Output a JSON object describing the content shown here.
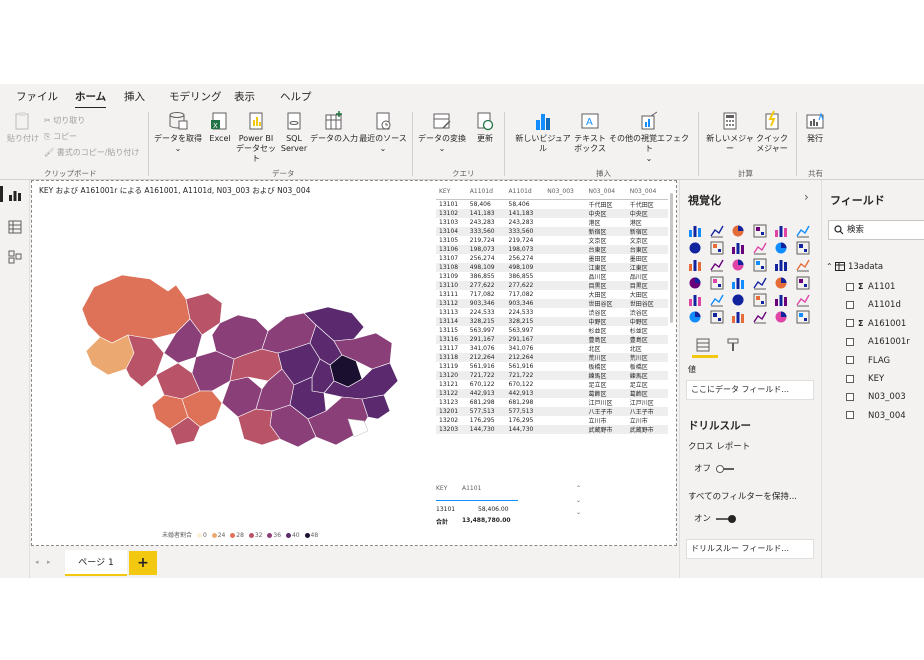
{
  "tabs": [
    "ファイル",
    "ホーム",
    "挿入",
    "モデリング",
    "表示",
    "ヘルプ"
  ],
  "active_tab": "ホーム",
  "ribbon": {
    "clipboard": {
      "paste": "貼り付け",
      "cut": "切り取り",
      "copy": "コピー",
      "format_painter": "書式のコピー/貼り付け",
      "group": "クリップボード"
    },
    "data": {
      "get_data": "データを取得",
      "excel": "Excel",
      "pbi_l1": "Power BI",
      "pbi_l2": "データセット",
      "sql_l1": "SQL",
      "sql_l2": "Server",
      "enter_data": "データの入力",
      "recent_sources": "最近のソース",
      "group": "データ"
    },
    "query": {
      "transform": "データの変換",
      "refresh": "更新",
      "group": "クエリ"
    },
    "insert": {
      "new_visual": "新しいビジュアル",
      "text_l1": "テキスト",
      "text_l2": "ボックス",
      "more_visuals": "その他の視覚エフェクト",
      "group": "挿入"
    },
    "calc": {
      "new_measure": "新しいメジャー",
      "quick_l1": "クイック",
      "quick_l2": "メジャー",
      "group": "計算"
    },
    "share": {
      "publish": "発行",
      "group": "共有"
    }
  },
  "map_visual": {
    "title": "KEY および A161001r による A161001, A1101d, N03_003 および N03_004",
    "legend_title": "未婚者割合",
    "legend": [
      {
        "label": "0",
        "color": "#fcefd8"
      },
      {
        "label": "24",
        "color": "#eba971"
      },
      {
        "label": "28",
        "color": "#de7259"
      },
      {
        "label": "32",
        "color": "#b95468"
      },
      {
        "label": "36",
        "color": "#8a3f78"
      },
      {
        "label": "40",
        "color": "#5b2a6e"
      },
      {
        "label": "48",
        "color": "#1a0f2e"
      }
    ]
  },
  "table": {
    "headers": [
      "KEY",
      "A1101d",
      "A1101d",
      "N03_003",
      "N03_004",
      "N03_004"
    ],
    "rows": [
      [
        "13101",
        "58,406",
        "58,406",
        "",
        "千代田区",
        "千代田区"
      ],
      [
        "13102",
        "141,183",
        "141,183",
        "",
        "中央区",
        "中央区"
      ],
      [
        "13103",
        "243,283",
        "243,283",
        "",
        "港区",
        "港区"
      ],
      [
        "13104",
        "333,560",
        "333,560",
        "",
        "新宿区",
        "新宿区"
      ],
      [
        "13105",
        "219,724",
        "219,724",
        "",
        "文京区",
        "文京区"
      ],
      [
        "13106",
        "198,073",
        "198,073",
        "",
        "台東区",
        "台東区"
      ],
      [
        "13107",
        "256,274",
        "256,274",
        "",
        "墨田区",
        "墨田区"
      ],
      [
        "13108",
        "498,109",
        "498,109",
        "",
        "江東区",
        "江東区"
      ],
      [
        "13109",
        "386,855",
        "386,855",
        "",
        "品川区",
        "品川区"
      ],
      [
        "13110",
        "277,622",
        "277,622",
        "",
        "目黒区",
        "目黒区"
      ],
      [
        "13111",
        "717,082",
        "717,082",
        "",
        "大田区",
        "大田区"
      ],
      [
        "13112",
        "903,346",
        "903,346",
        "",
        "世田谷区",
        "世田谷区"
      ],
      [
        "13113",
        "224,533",
        "224,533",
        "",
        "渋谷区",
        "渋谷区"
      ],
      [
        "13114",
        "328,215",
        "328,215",
        "",
        "中野区",
        "中野区"
      ],
      [
        "13115",
        "563,997",
        "563,997",
        "",
        "杉並区",
        "杉並区"
      ],
      [
        "13116",
        "291,167",
        "291,167",
        "",
        "豊島区",
        "豊島区"
      ],
      [
        "13117",
        "341,076",
        "341,076",
        "",
        "北区",
        "北区"
      ],
      [
        "13118",
        "212,264",
        "212,264",
        "",
        "荒川区",
        "荒川区"
      ],
      [
        "13119",
        "561,916",
        "561,916",
        "",
        "板橋区",
        "板橋区"
      ],
      [
        "13120",
        "721,722",
        "721,722",
        "",
        "練馬区",
        "練馬区"
      ],
      [
        "13121",
        "670,122",
        "670,122",
        "",
        "足立区",
        "足立区"
      ],
      [
        "13122",
        "442,913",
        "442,913",
        "",
        "葛飾区",
        "葛飾区"
      ],
      [
        "13123",
        "681,298",
        "681,298",
        "",
        "江戸川区",
        "江戸川区"
      ],
      [
        "13201",
        "577,513",
        "577,513",
        "",
        "八王子市",
        "八王子市"
      ],
      [
        "13202",
        "176,295",
        "176,295",
        "",
        "立川市",
        "立川市"
      ],
      [
        "13203",
        "144,730",
        "144,730",
        "",
        "武蔵野市",
        "武蔵野市"
      ]
    ]
  },
  "table2": {
    "headers": [
      "KEY",
      "A1101"
    ],
    "row": [
      "13101",
      "58,406.00"
    ],
    "total_label": "合計",
    "total_value": "13,488,780.00"
  },
  "pages": {
    "tab": "ページ 1",
    "add": "+"
  },
  "visualizations": {
    "title": "視覚化",
    "collapse": "›",
    "values_label": "値",
    "add_field": "ここにデータ フィールド...",
    "drillthrough_title": "ドリルスルー",
    "cross_report": "クロス レポート",
    "cross_report_state": "オフ",
    "keep_filters": "すべてのフィルターを保持...",
    "keep_filters_state": "オン",
    "drill_field": "ドリルスルー フィールド..."
  },
  "fields": {
    "title": "フィールド",
    "search_placeholder": "検索",
    "table_name": "13adata",
    "items": [
      {
        "name": "A1101",
        "sigma": "Σ"
      },
      {
        "name": "A1101d",
        "sigma": ""
      },
      {
        "name": "A161001",
        "sigma": "Σ"
      },
      {
        "name": "A161001r",
        "sigma": ""
      },
      {
        "name": "FLAG",
        "sigma": ""
      },
      {
        "name": "KEY",
        "sigma": ""
      },
      {
        "name": "N03_003",
        "sigma": ""
      },
      {
        "name": "N03_004",
        "sigma": ""
      }
    ]
  }
}
